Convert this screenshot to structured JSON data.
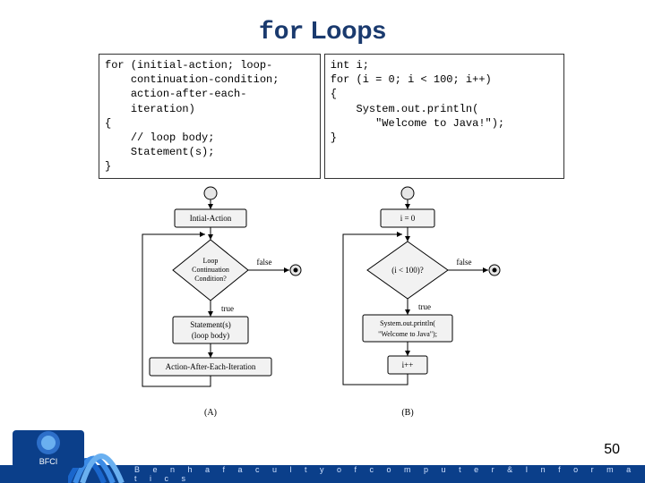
{
  "title": {
    "mono": "for",
    "rest": " Loops"
  },
  "code": {
    "left": "for (initial-action; loop-\n    continuation-condition;\n    action-after-each-\n    iteration)\n{\n    // loop body;\n    Statement(s);\n}",
    "right": "int i;\nfor (i = 0; i < 100; i++)\n{\n    System.out.println(\n       \"Welcome to Java!\");\n}"
  },
  "flowchart": {
    "a": {
      "init": "Intial-Action",
      "cond1": "Loop",
      "cond2": "Continuation",
      "cond3": "Condition?",
      "true": "true",
      "false": "false",
      "body1": "Statement(s)",
      "body2": "(loop body)",
      "after": "Action-After-Each-Iteration",
      "label": "(A)"
    },
    "b": {
      "init": "i = 0",
      "cond": "(i < 100)?",
      "true": "true",
      "false": "false",
      "body1": "System.out.println(",
      "body2": "\"Welcome to Java\");",
      "after": "i++",
      "label": "(B)"
    }
  },
  "footer": {
    "text": "B e n h a   f a c u l t y   o f   c o m p u t e r   &   I n f o r m a t i c s",
    "badge": "BFCI"
  },
  "page": "50"
}
